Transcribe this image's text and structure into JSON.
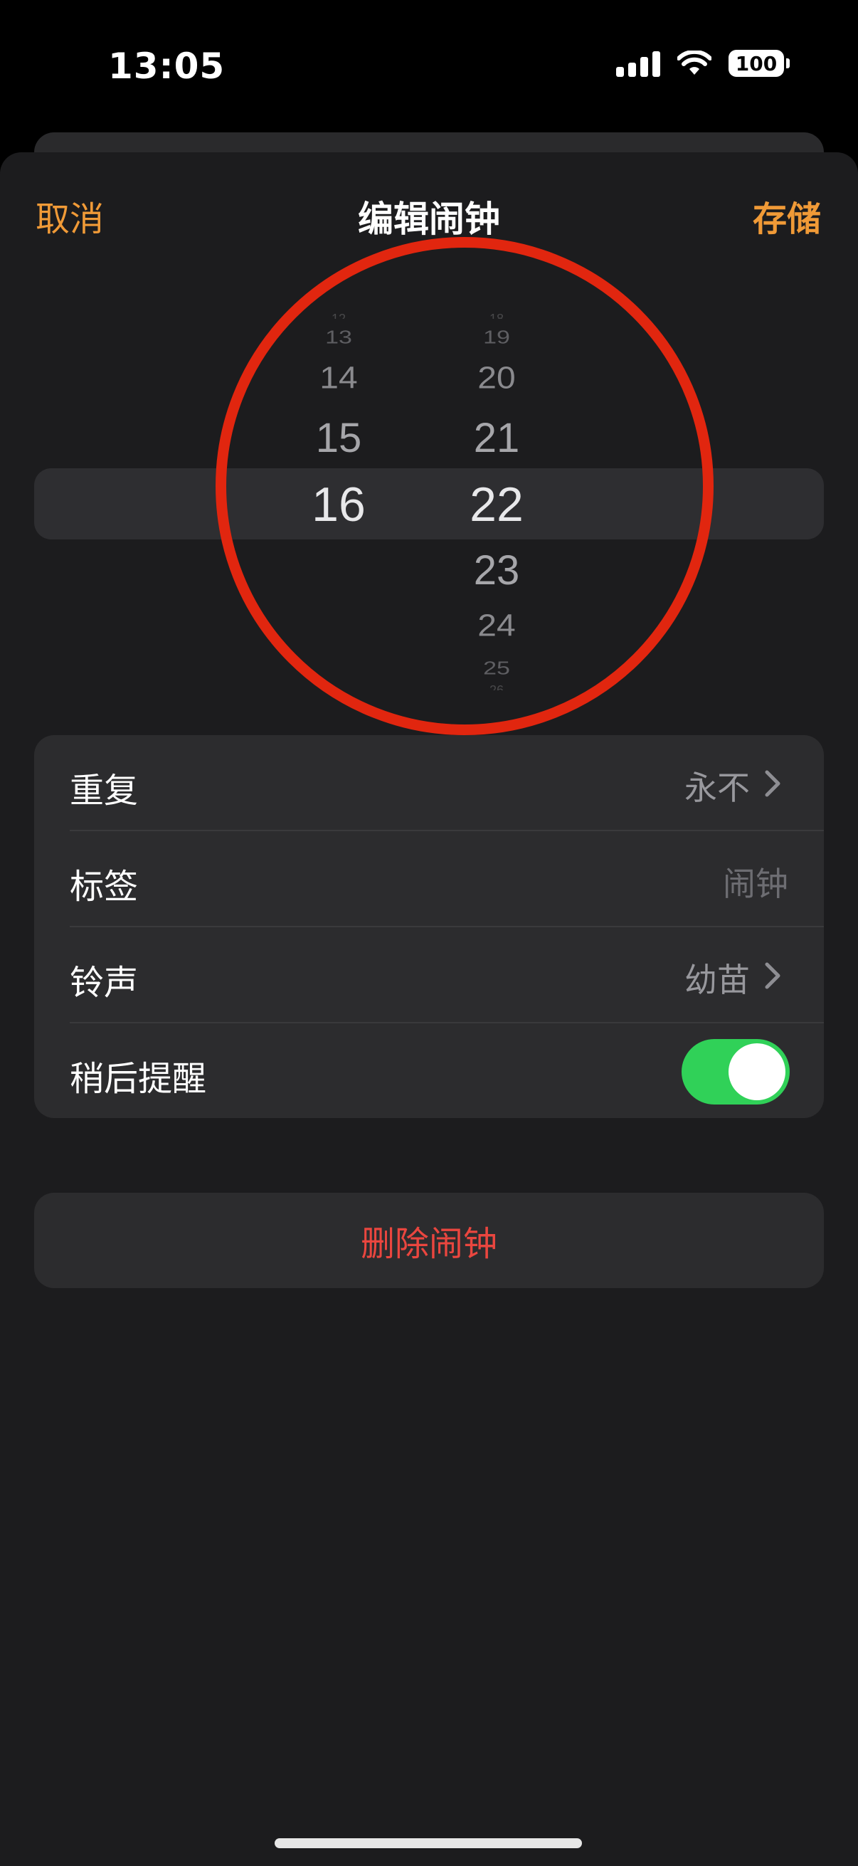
{
  "status_bar": {
    "time": "13:05",
    "battery": "100"
  },
  "nav": {
    "cancel_label": "取消",
    "title": "编辑闹钟",
    "save_label": "存储"
  },
  "time_picker": {
    "hour_selected": "16",
    "minute_selected": "22",
    "hours_above": [
      "12",
      "13",
      "14",
      "15"
    ],
    "minutes_above": [
      "18",
      "19",
      "20",
      "21"
    ],
    "minutes_below": [
      "23",
      "24",
      "25",
      "26"
    ]
  },
  "settings": {
    "repeat": {
      "label": "重复",
      "value": "永不"
    },
    "label": {
      "label": "标签",
      "value": "闹钟"
    },
    "sound": {
      "label": "铃声",
      "value": "幼苗"
    },
    "snooze": {
      "label": "稍后提醒",
      "on": true
    }
  },
  "delete_label": "删除闹钟",
  "colors": {
    "accent": "#f09a37",
    "destructive": "#ea463f",
    "toggle_on": "#30d158",
    "annotation_circle": "#e1260f"
  }
}
